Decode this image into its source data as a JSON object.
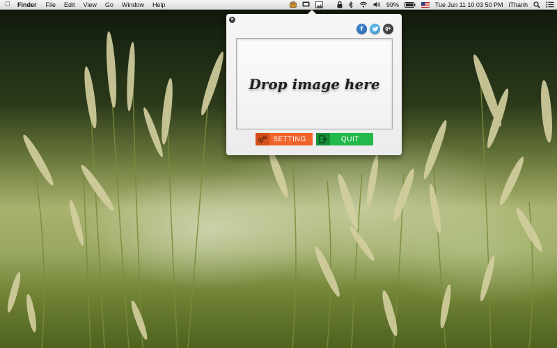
{
  "menubar": {
    "app_name": "Finder",
    "menus": [
      "File",
      "Edit",
      "View",
      "Go",
      "Window",
      "Help"
    ],
    "battery_percent": "99%",
    "datetime": "Tue Jun 11  10 03 50 PM",
    "username": "iThanh"
  },
  "panel": {
    "close_label": "×",
    "social": {
      "facebook": "f",
      "twitter": "t",
      "googleplus": "g+"
    },
    "drop_text": "Drop image here",
    "setting_label": "SETTING",
    "quit_label": "QUIT"
  },
  "colors": {
    "setting_button": "#f0642a",
    "quit_button": "#22b84c",
    "menubar": "#e8e8e8"
  },
  "icons": {
    "apple": "apple-icon",
    "lock": "lock-icon",
    "wifi": "wifi-icon",
    "volume": "volume-icon",
    "battery": "battery-icon",
    "flag": "us-flag-icon",
    "search": "search-icon",
    "list": "notification-list-icon"
  }
}
